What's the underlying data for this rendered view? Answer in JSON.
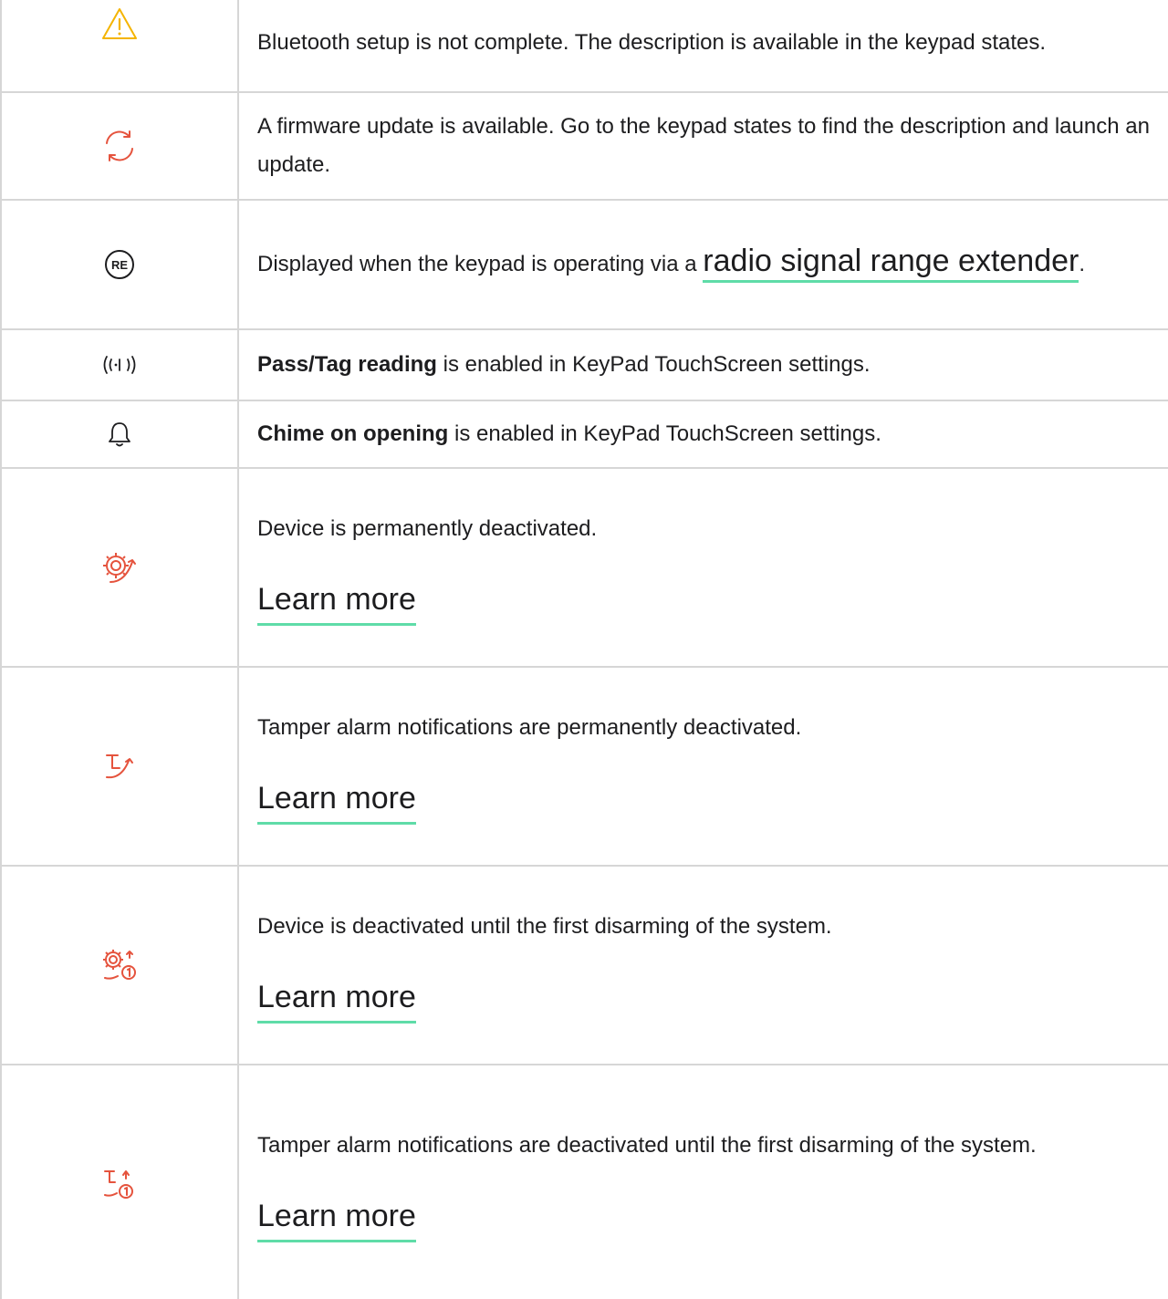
{
  "colors": {
    "warning": "#f4b400",
    "alert": "#e5533d",
    "neutral": "#1d1d1f",
    "link_underline": "#5fdca8",
    "border": "#d6d6d6"
  },
  "rows": [
    {
      "icon": "warning-triangle-icon",
      "text": "Bluetooth setup is not complete. The description is available in the keypad states."
    },
    {
      "icon": "firmware-update-icon",
      "text": "A firmware update is available. Go to the keypad states to find the description and launch an update."
    },
    {
      "icon": "range-extender-icon",
      "icon_label": "RE",
      "text_before": "Displayed when the keypad is operating via a ",
      "link": "radio signal range extender",
      "text_after": "."
    },
    {
      "icon": "pass-tag-reading-icon",
      "bold": "Pass/Tag reading",
      "text": " is enabled in KeyPad TouchScreen settings."
    },
    {
      "icon": "bell-icon",
      "bold": "Chime on opening",
      "text": " is enabled in KeyPad TouchScreen settings."
    },
    {
      "icon": "device-deactivated-icon",
      "text": "Device is permanently deactivated.",
      "link": "Learn more"
    },
    {
      "icon": "tamper-deactivated-icon",
      "text": "Tamper alarm notifications are permanently deactivated.",
      "link": "Learn more"
    },
    {
      "icon": "device-deactivated-until-disarm-icon",
      "text": "Device is deactivated until the first disarming of the system.",
      "link": "Learn more"
    },
    {
      "icon": "tamper-deactivated-until-disarm-icon",
      "text": "Tamper alarm notifications are deactivated until the first disarming of the system.",
      "link": "Learn more"
    }
  ]
}
